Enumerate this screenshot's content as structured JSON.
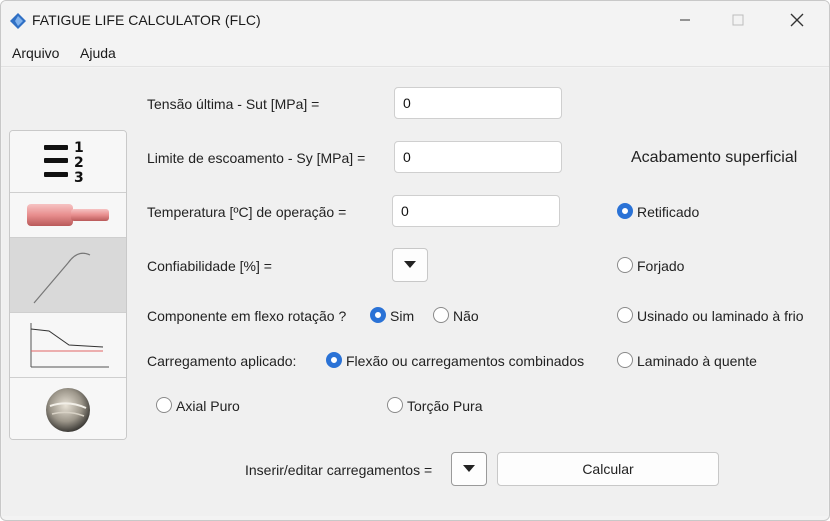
{
  "window": {
    "title": "FATIGUE LIFE CALCULATOR (FLC)"
  },
  "menu": {
    "file": "Arquivo",
    "help": "Ajuda"
  },
  "toolbar": {
    "items": [
      "list-numbered-icon",
      "shaft-icon",
      "stress-strain-curve-icon",
      "fatigue-curve-icon",
      "material-sample-icon"
    ],
    "active_index": 2
  },
  "form": {
    "sut_label": "Tensão última - Sut [MPa] =",
    "sut_value": "0",
    "sy_label": "Limite de escoamento - Sy [MPa] =",
    "sy_value": "0",
    "temp_label": "Temperatura [ºC] de operação =",
    "temp_value": "0",
    "reliability_label": "Confiabilidade [%] =",
    "rotation_label": "Componente em flexo rotação ?",
    "rotation_yes": "Sim",
    "rotation_no": "Não",
    "load_label": "Carregamento aplicado:",
    "load_bending": "Flexão ou carregamentos combinados",
    "load_axial": "Axial Puro",
    "load_torsion": "Torção Pura",
    "insert_label": "Inserir/editar carregamentos =",
    "calculate": "Calcular"
  },
  "finish": {
    "heading": "Acabamento superficial",
    "options": [
      "Retificado",
      "Forjado",
      "Usinado ou laminado à frio",
      "Laminado à quente"
    ],
    "selected": "Retificado"
  },
  "colors": {
    "accent": "#2a72d6"
  }
}
